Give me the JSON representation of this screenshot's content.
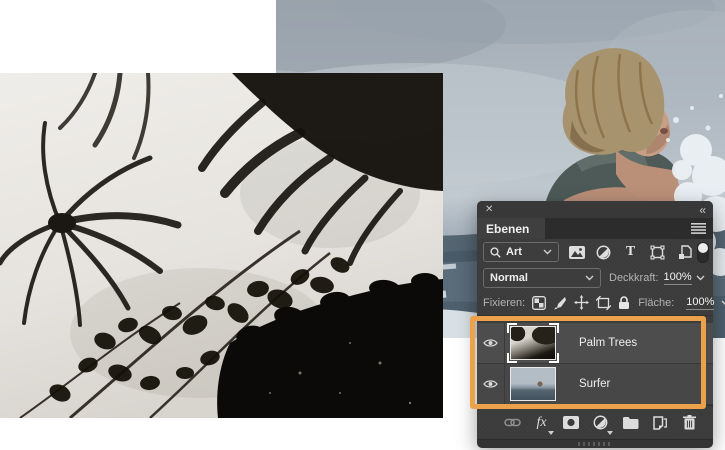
{
  "photos": {
    "palm": {
      "name": "Palm Trees"
    },
    "surfer": {
      "name": "Surfer"
    }
  },
  "panel": {
    "close_icon": "✕",
    "collapse_icon": "«",
    "title": "Ebenen",
    "filter": {
      "search_value": "Art",
      "type_filter_glyph": "T"
    },
    "blend": {
      "mode_value": "Normal",
      "opacity_label": "Deckkraft:",
      "opacity_value": "100%"
    },
    "lock": {
      "label": "Fixieren:",
      "fill_label": "Fläche:",
      "fill_value": "100%"
    },
    "layers": [
      {
        "name": "Palm Trees",
        "visible": true,
        "selected": true
      },
      {
        "name": "Surfer",
        "visible": true,
        "selected": false
      }
    ],
    "footer": {
      "fx_label": "fx"
    },
    "icons": [
      "close-icon",
      "collapse-icon",
      "panel-menu-icon",
      "search-icon",
      "chevron-down-icon",
      "pixel-filter-icon",
      "adjustment-filter-icon",
      "type-filter-icon",
      "shape-filter-icon",
      "smart-object-filter-icon",
      "filter-toggle",
      "lock-transparency-icon",
      "lock-pixels-icon",
      "lock-position-icon",
      "lock-artboard-icon",
      "lock-all-icon",
      "eye-icon",
      "link-icon",
      "fx-icon",
      "mask-icon",
      "adjustment-icon",
      "folder-icon",
      "new-layer-icon",
      "trash-icon"
    ]
  },
  "colors": {
    "highlight_orange": "#ECA24B",
    "panel_bg": "#3B3B3B",
    "selected_row": "#4D4D4D",
    "page_bg": "#FFFFFF"
  }
}
